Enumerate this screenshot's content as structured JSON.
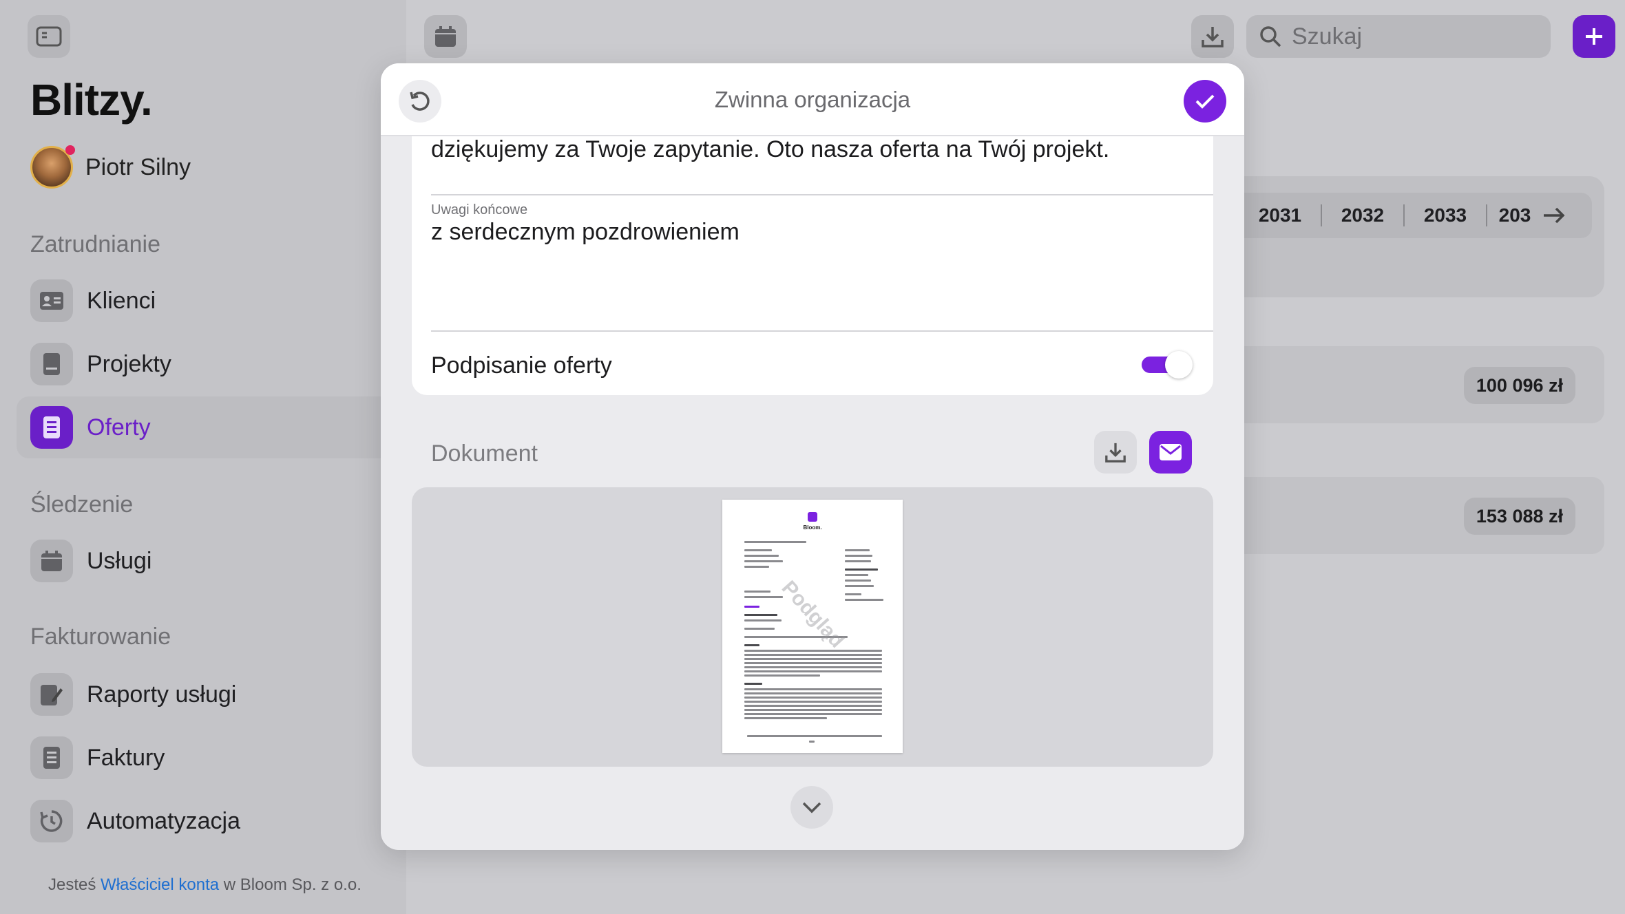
{
  "app": {
    "logo": "Blitzy."
  },
  "user": {
    "name": "Piotr Silny"
  },
  "sidebar": {
    "sections": [
      {
        "title": "Zatrudnianie",
        "items": [
          {
            "label": "Klienci",
            "icon": "contact-card-icon"
          },
          {
            "label": "Projekty",
            "icon": "document-icon"
          },
          {
            "label": "Oferty",
            "icon": "receipt-icon",
            "active": true
          }
        ]
      },
      {
        "title": "Śledzenie",
        "items": [
          {
            "label": "Usługi",
            "icon": "calendar-icon"
          }
        ]
      },
      {
        "title": "Fakturowanie",
        "items": [
          {
            "label": "Raporty usługi",
            "icon": "report-edit-icon"
          },
          {
            "label": "Faktury",
            "icon": "invoice-icon"
          },
          {
            "label": "Automatyzacja",
            "icon": "history-icon"
          }
        ]
      }
    ]
  },
  "footer": {
    "prefix": "Jesteś",
    "link": "Właściciel konta",
    "suffix": "w Bloom Sp. z o.o."
  },
  "topbar": {
    "search_placeholder": "Szukaj"
  },
  "years": [
    "2031",
    "2032",
    "2033",
    "203"
  ],
  "amounts": [
    "100 096 zł",
    "153 088 zł"
  ],
  "modal": {
    "title": "Zwinna organizacja",
    "intro_text": "dziękujemy za Twoje zapytanie. Oto nasza oferta na Twój projekt.",
    "closing_label": "Uwagi końcowe",
    "closing_value": "z serdecznym pozdrowieniem",
    "sign_label": "Podpisanie oferty",
    "sign_enabled": true,
    "document_label": "Dokument",
    "preview": {
      "brand": "Bloom.",
      "watermark": "Podgląd"
    }
  },
  "colors": {
    "accent": "#7b22e0",
    "link": "#1f6fd0"
  }
}
